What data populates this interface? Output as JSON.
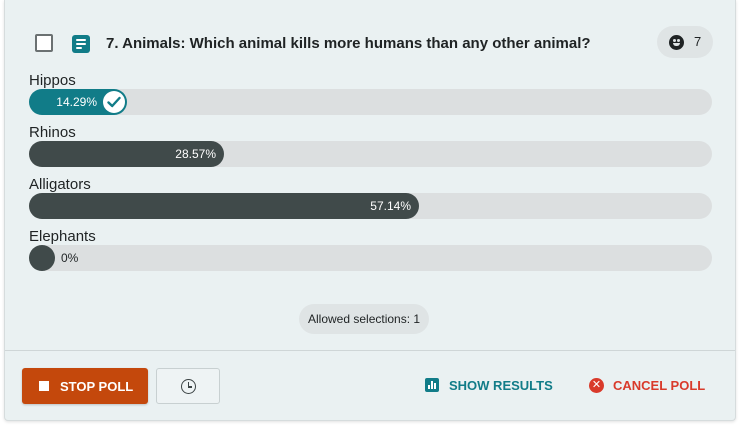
{
  "poll": {
    "number_title": "7. Animals: Which animal kills more humans than any other animal?",
    "voters_count": "7",
    "options": [
      {
        "label": "Hippos",
        "percent_text": "14.29%",
        "fraction": 0.1429,
        "selected": true
      },
      {
        "label": "Rhinos",
        "percent_text": "28.57%",
        "fraction": 0.2857,
        "selected": false
      },
      {
        "label": "Alligators",
        "percent_text": "57.14%",
        "fraction": 0.5714,
        "selected": false
      },
      {
        "label": "Elephants",
        "percent_text": "0%",
        "fraction": 0,
        "selected": false
      }
    ],
    "allowed_selections": "Allowed selections: 1"
  },
  "footer": {
    "stop_poll_label": "STOP POLL",
    "show_results_label": "SHOW RESULTS",
    "cancel_poll_label": "CANCEL POLL"
  },
  "colors": {
    "accent": "#117c88",
    "bar_fill": "#404a4a",
    "stop_button": "#c4480c",
    "cancel": "#d93a2b"
  },
  "icons": {
    "question_type": "poll-list-icon",
    "voters": "smiley-icon",
    "selected": "check-circle-icon",
    "stop": "stop-square-icon",
    "timer": "clock-icon",
    "results": "bar-chart-icon",
    "cancel": "x-circle-icon"
  }
}
